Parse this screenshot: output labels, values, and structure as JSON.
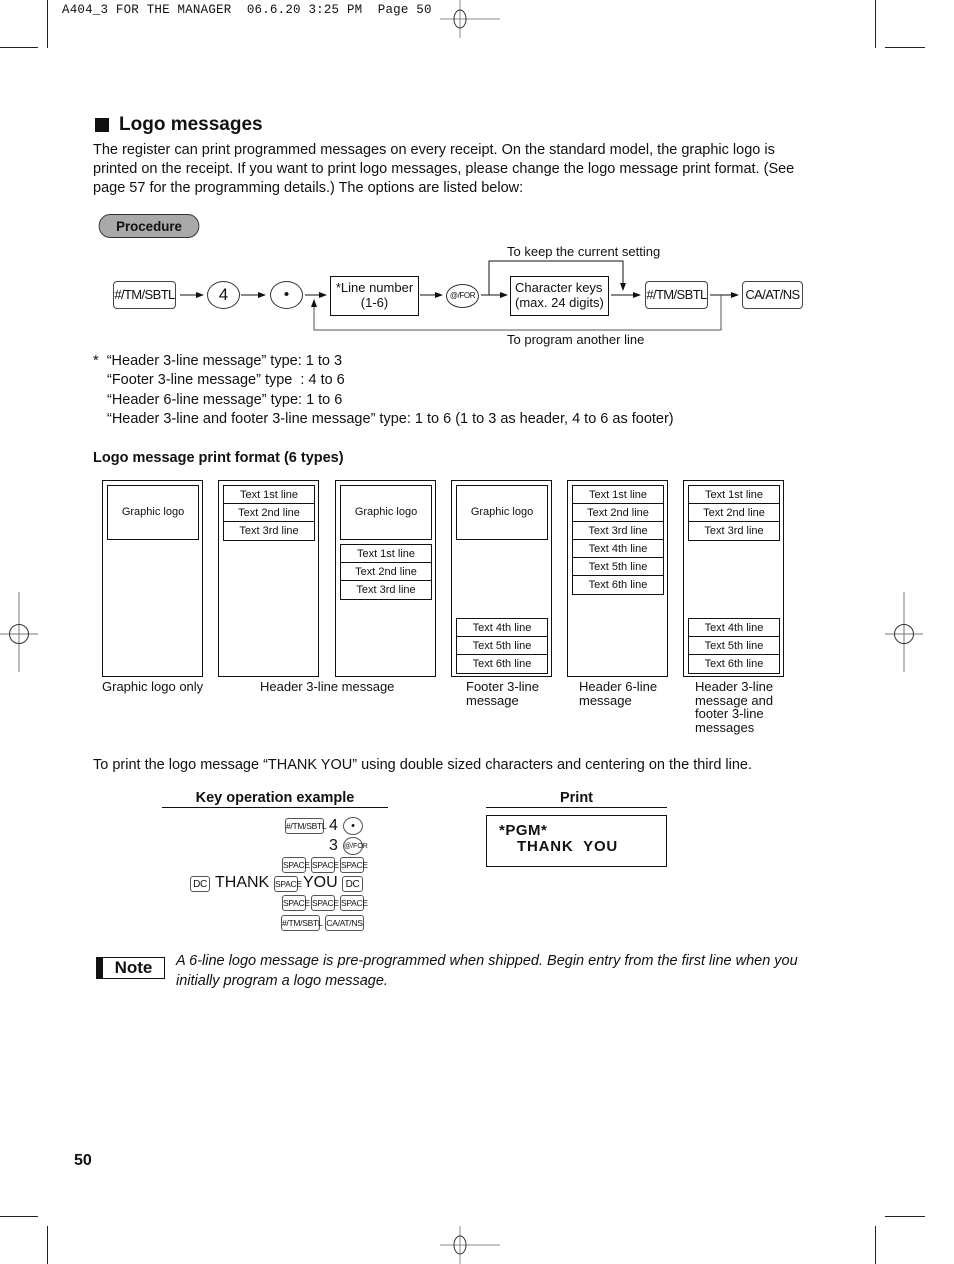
{
  "print_header": "A404_3 FOR THE MANAGER  06.6.20 3:25 PM  Page 50",
  "section": {
    "title": "Logo messages",
    "intro_lines": [
      "The register can print programmed messages on every receipt. On the standard model, the graphic logo is",
      "printed on the receipt.  If you want to print logo messages, please change the logo message print format. (See",
      "page 57 for the programming details.)  The options are listed below:"
    ]
  },
  "procedure": {
    "label": "Procedure",
    "keys": {
      "start": "#/TM/SBTL",
      "digit": "4",
      "dot": "•",
      "for": "@/FOR",
      "end_sbtl": "#/TM/SBTL",
      "finish": "CA/AT/NS"
    },
    "line_number_box": [
      "*Line number",
      "(1-6)"
    ],
    "char_keys_box": [
      "Character keys",
      "(max. 24 digits)"
    ],
    "keep_label": "To keep the current setting",
    "loop_label": "To program another line"
  },
  "footnotes": [
    "*  “Header 3-line message” type: 1 to 3",
    "“Footer 3-line message” type  : 4 to 6",
    "“Header 6-line message” type: 1 to 6",
    "“Header 3-line and footer 3-line message” type: 1 to 6 (1 to 3 as header, 4 to 6 as footer)"
  ],
  "formats": {
    "heading": "Logo message print format (6 types)",
    "graphic_logo": "Graphic logo",
    "lines": [
      "Text 1st line",
      "Text 2nd line",
      "Text 3rd line",
      "Text 4th line",
      "Text 5th line",
      "Text 6th line"
    ],
    "captions": {
      "graphic_only": "Graphic logo only",
      "header3": "Header 3-line message",
      "footer3": [
        "Footer 3-line",
        "message"
      ],
      "header6": [
        "Header 6-line",
        "message"
      ],
      "header_footer": [
        "Header 3-line",
        "message and",
        "footer 3-line",
        "messages"
      ]
    }
  },
  "example": {
    "intro": "To print the logo message “THANK YOU” using double sized characters and centering on the third line.",
    "key_op_heading": "Key operation example",
    "print_heading": "Print",
    "keys": {
      "sbtl": "#/TM/SBTL",
      "four": "4",
      "dot": "•",
      "three": "3",
      "for": "@/FOR",
      "space": "SPACE",
      "dc": "DC",
      "thank": "THANK",
      "you": "YOU",
      "finish": "CA/AT/NS"
    },
    "print_lines": [
      "*PGM*",
      "THANK  YOU"
    ]
  },
  "note": {
    "badge": "Note",
    "text_lines": [
      "A 6-line logo message is pre-programmed when shipped.  Begin entry from the first line when you",
      "initially program a logo message."
    ]
  },
  "page_number": "50"
}
